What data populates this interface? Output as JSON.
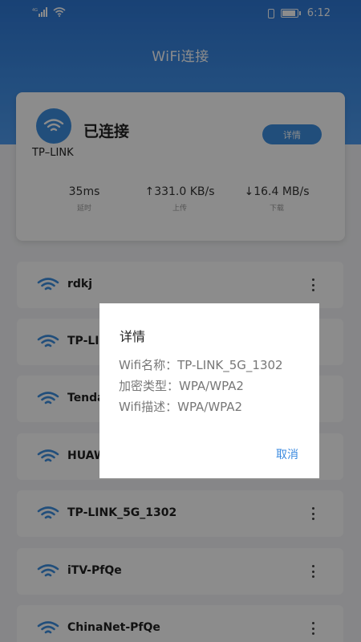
{
  "status_bar": {
    "time": "6:12"
  },
  "app": {
    "title": "WiFi连接"
  },
  "connection": {
    "status": "已连接",
    "ssid": "TP–LINK",
    "detail_button": "详情",
    "stats": [
      {
        "value": "35ms",
        "label": "延时"
      },
      {
        "value": "↑331.0 KB/s",
        "label": "上传"
      },
      {
        "value": "↓16.4 MB/s",
        "label": "下载"
      }
    ]
  },
  "networks": [
    {
      "name": "rdkj"
    },
    {
      "name": "TP-LI"
    },
    {
      "name": "Tenda"
    },
    {
      "name": "HUAW"
    },
    {
      "name": "TP-LINK_5G_1302"
    },
    {
      "name": "iTV-PfQe"
    },
    {
      "name": "ChinaNet-PfQe"
    }
  ],
  "dialog": {
    "title": "详情",
    "lines": [
      "Wifi名称：TP-LINK_5G_1302",
      "加密类型：WPA/WPA2",
      "Wifi描述：WPA/WPA2"
    ],
    "cancel": "取消"
  },
  "colors": {
    "accent": "#3d8fe0",
    "header": "#3f8ee6"
  }
}
